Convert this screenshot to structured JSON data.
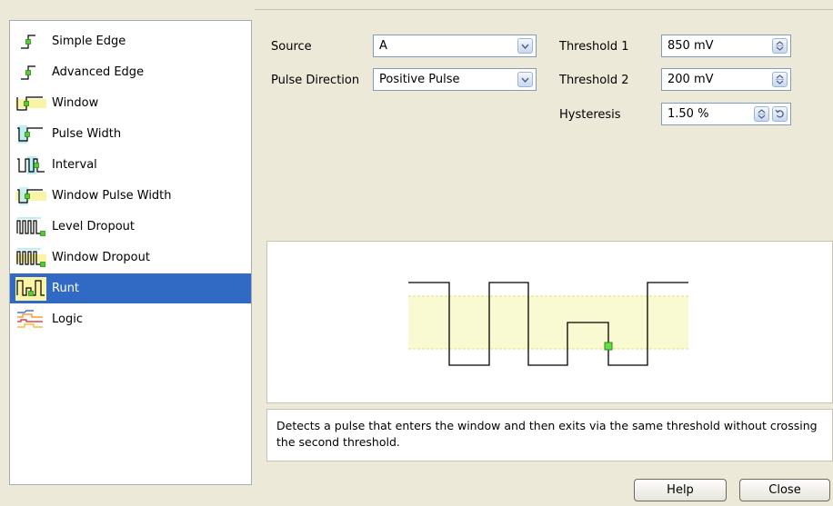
{
  "trigger_types": [
    {
      "label": "Simple Edge",
      "icon": "simple-edge-icon",
      "selected": false
    },
    {
      "label": "Advanced Edge",
      "icon": "advanced-edge-icon",
      "selected": false
    },
    {
      "label": "Window",
      "icon": "window-icon",
      "selected": false
    },
    {
      "label": "Pulse Width",
      "icon": "pulse-width-icon",
      "selected": false
    },
    {
      "label": "Interval",
      "icon": "interval-icon",
      "selected": false
    },
    {
      "label": "Window Pulse Width",
      "icon": "window-pulse-width-icon",
      "selected": false
    },
    {
      "label": "Level Dropout",
      "icon": "level-dropout-icon",
      "selected": false
    },
    {
      "label": "Window Dropout",
      "icon": "window-dropout-icon",
      "selected": false
    },
    {
      "label": "Runt",
      "icon": "runt-icon",
      "selected": true
    },
    {
      "label": "Logic",
      "icon": "logic-icon",
      "selected": false
    }
  ],
  "settings": {
    "source_label": "Source",
    "source_value": "A",
    "pulse_direction_label": "Pulse Direction",
    "pulse_direction_value": "Positive Pulse",
    "threshold1_label": "Threshold 1",
    "threshold1_value": "850 mV",
    "threshold2_label": "Threshold 2",
    "threshold2_value": "200 mV",
    "hysteresis_label": "Hysteresis",
    "hysteresis_value": "1.50 %"
  },
  "description": "Detects a pulse that enters the window and then exits via the same threshold without crossing the second threshold.",
  "buttons": {
    "help": "Help",
    "close": "Close"
  },
  "colors": {
    "selection": "#316ac5",
    "window_band": "#fafad2",
    "trigger_point": "#66dd44"
  }
}
